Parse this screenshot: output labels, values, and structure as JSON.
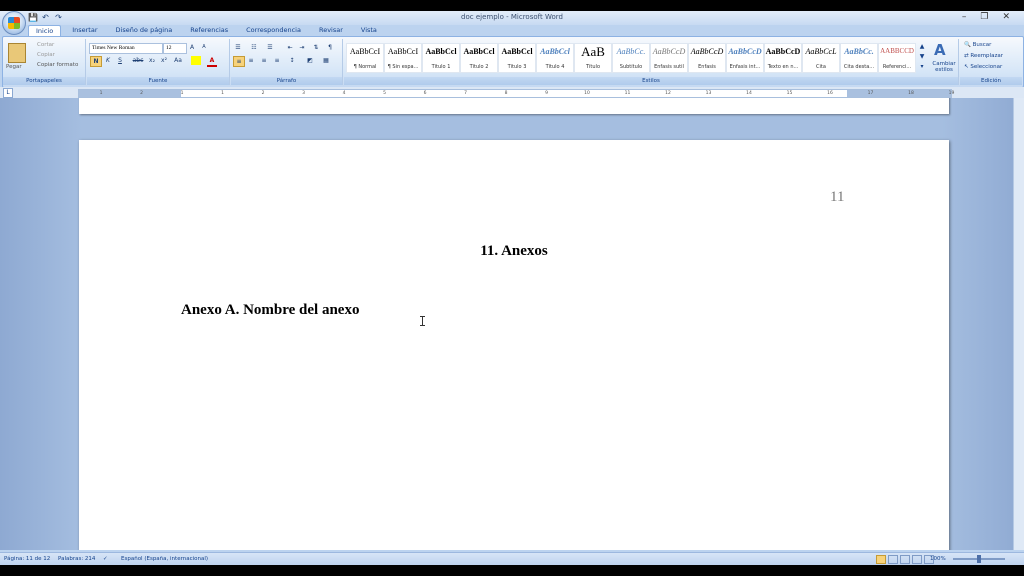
{
  "window": {
    "title": "doc ejemplo - Microsoft Word",
    "minimize": "–",
    "restore": "❐",
    "close": "✕"
  },
  "qat": {
    "save": "💾",
    "undo": "↶",
    "redo": "↷"
  },
  "tabs": [
    "Inicio",
    "Insertar",
    "Diseño de página",
    "Referencias",
    "Correspondencia",
    "Revisar",
    "Vista"
  ],
  "clipboard": {
    "paste": "Pegar",
    "cut": "Cortar",
    "copy": "Copiar",
    "format_painter": "Copiar formato",
    "label": "Portapapeles"
  },
  "font": {
    "name": "Times New Roman",
    "size": "12",
    "label": "Fuente",
    "bold": "N",
    "italic": "K",
    "underline": "S",
    "strike": "abc",
    "sub": "x₂",
    "sup": "x²",
    "case": "Aa",
    "grow": "A",
    "shrink": "A"
  },
  "paragraph": {
    "label": "Párrafo"
  },
  "styles": {
    "label": "Estilos",
    "items": [
      {
        "preview": "AaBbCcI",
        "name": "¶ Normal"
      },
      {
        "preview": "AaBbCcI",
        "name": "¶ Sin espa..."
      },
      {
        "preview": "AaBbCcl",
        "name": "Título 1"
      },
      {
        "preview": "AaBbCcl",
        "name": "Título 2"
      },
      {
        "preview": "AaBbCcl",
        "name": "Título 3"
      },
      {
        "preview": "AaBbCcl",
        "name": "Título 4"
      },
      {
        "preview": "AaB",
        "name": "Título"
      },
      {
        "preview": "AaBbCc.",
        "name": "Subtítulo"
      },
      {
        "preview": "AaBbCcD",
        "name": "Énfasis sutil"
      },
      {
        "preview": "AaBbCcD",
        "name": "Énfasis"
      },
      {
        "preview": "AaBbCcD",
        "name": "Énfasis int..."
      },
      {
        "preview": "AaBbCcD",
        "name": "Texto en n..."
      },
      {
        "preview": "AaBbCcL",
        "name": "Cita"
      },
      {
        "preview": "AaBbCc.",
        "name": "Cita desta..."
      },
      {
        "preview": "AABBCCD",
        "name": "Referenci..."
      }
    ],
    "change": "Cambiar estilos"
  },
  "editing": {
    "label": "Edición",
    "find": "Buscar",
    "replace": "Reemplazar",
    "select": "Seleccionar"
  },
  "ruler": {
    "numbers": [
      "1",
      "2",
      "1",
      "1",
      "2",
      "3",
      "4",
      "5",
      "6",
      "7",
      "8",
      "9",
      "10",
      "11",
      "12",
      "13",
      "14",
      "15",
      "16",
      "17",
      "18",
      "19"
    ]
  },
  "document": {
    "page_number": "11",
    "heading1": "11. Anexos",
    "heading2": "Anexo A. Nombre del anexo"
  },
  "status": {
    "page": "Página: 11 de 12",
    "words": "Palabras: 214",
    "language": "Español (España, internacional)",
    "zoom": "100%"
  }
}
